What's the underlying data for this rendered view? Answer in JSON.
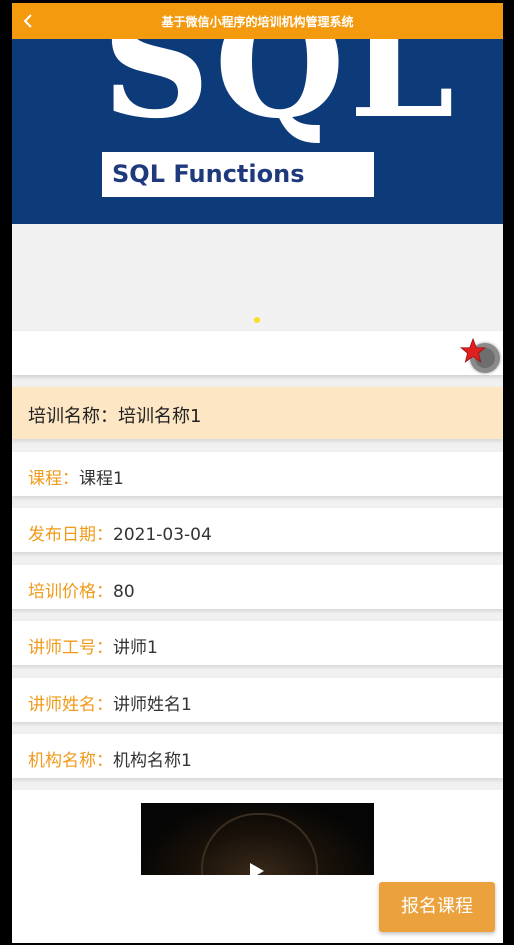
{
  "nav": {
    "title": "基于微信小程序的培训机构管理系统",
    "back_icon": "chevron-left-icon"
  },
  "banner": {
    "big_text": "SQL",
    "box_text": "SQL Functions"
  },
  "collect": {
    "star_icon": "star-icon",
    "star_color": "#e02020"
  },
  "detail": {
    "title_label": "培训名称：",
    "title_value": "培训名称1",
    "fields": [
      {
        "label": "课程：",
        "value": "课程1"
      },
      {
        "label": "发布日期：",
        "value": "2021-03-04"
      },
      {
        "label": "培训价格：",
        "value": "80"
      },
      {
        "label": "讲师工号：",
        "value": "讲师1"
      },
      {
        "label": "讲师姓名：",
        "value": "讲师姓名1"
      },
      {
        "label": "机构名称：",
        "value": "机构名称1"
      }
    ]
  },
  "video": {
    "play_icon": "play-icon"
  },
  "actions": {
    "enroll_label": "报名课程"
  },
  "colors": {
    "accent": "#f39a0e",
    "label": "#f09a1a",
    "title_bg": "#fde6c4",
    "button": "#eba23c"
  }
}
